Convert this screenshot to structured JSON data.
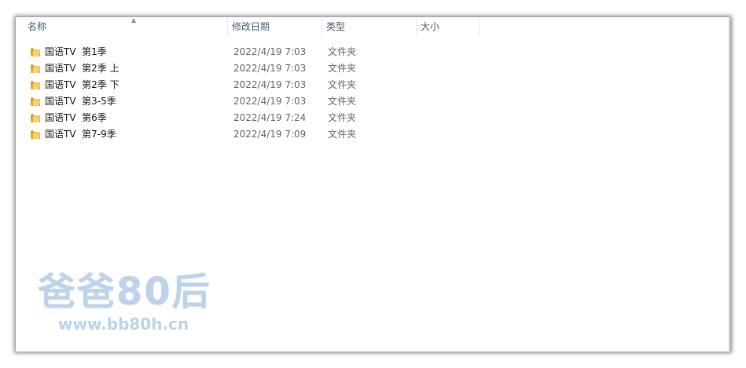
{
  "columns": {
    "name": "名称",
    "date": "修改日期",
    "type": "类型",
    "size": "大小"
  },
  "sort_indicator": "▲",
  "files": [
    {
      "name": "国语TV  第1季",
      "date": "2022/4/19 7:03",
      "type": "文件夹"
    },
    {
      "name": "国语TV  第2季 上",
      "date": "2022/4/19 7:03",
      "type": "文件夹"
    },
    {
      "name": "国语TV  第2季 下",
      "date": "2022/4/19 7:03",
      "type": "文件夹"
    },
    {
      "name": "国语TV  第3-5季",
      "date": "2022/4/19 7:03",
      "type": "文件夹"
    },
    {
      "name": "国语TV  第6季",
      "date": "2022/4/19 7:24",
      "type": "文件夹"
    },
    {
      "name": "国语TV  第7-9季",
      "date": "2022/4/19 7:09",
      "type": "文件夹"
    }
  ],
  "watermark": {
    "title": "爸爸80后",
    "url": "www.bb80h.cn"
  },
  "colors": {
    "folder": "#f2c34a",
    "header_text": "#4c607a",
    "watermark": "#bed3ea"
  }
}
